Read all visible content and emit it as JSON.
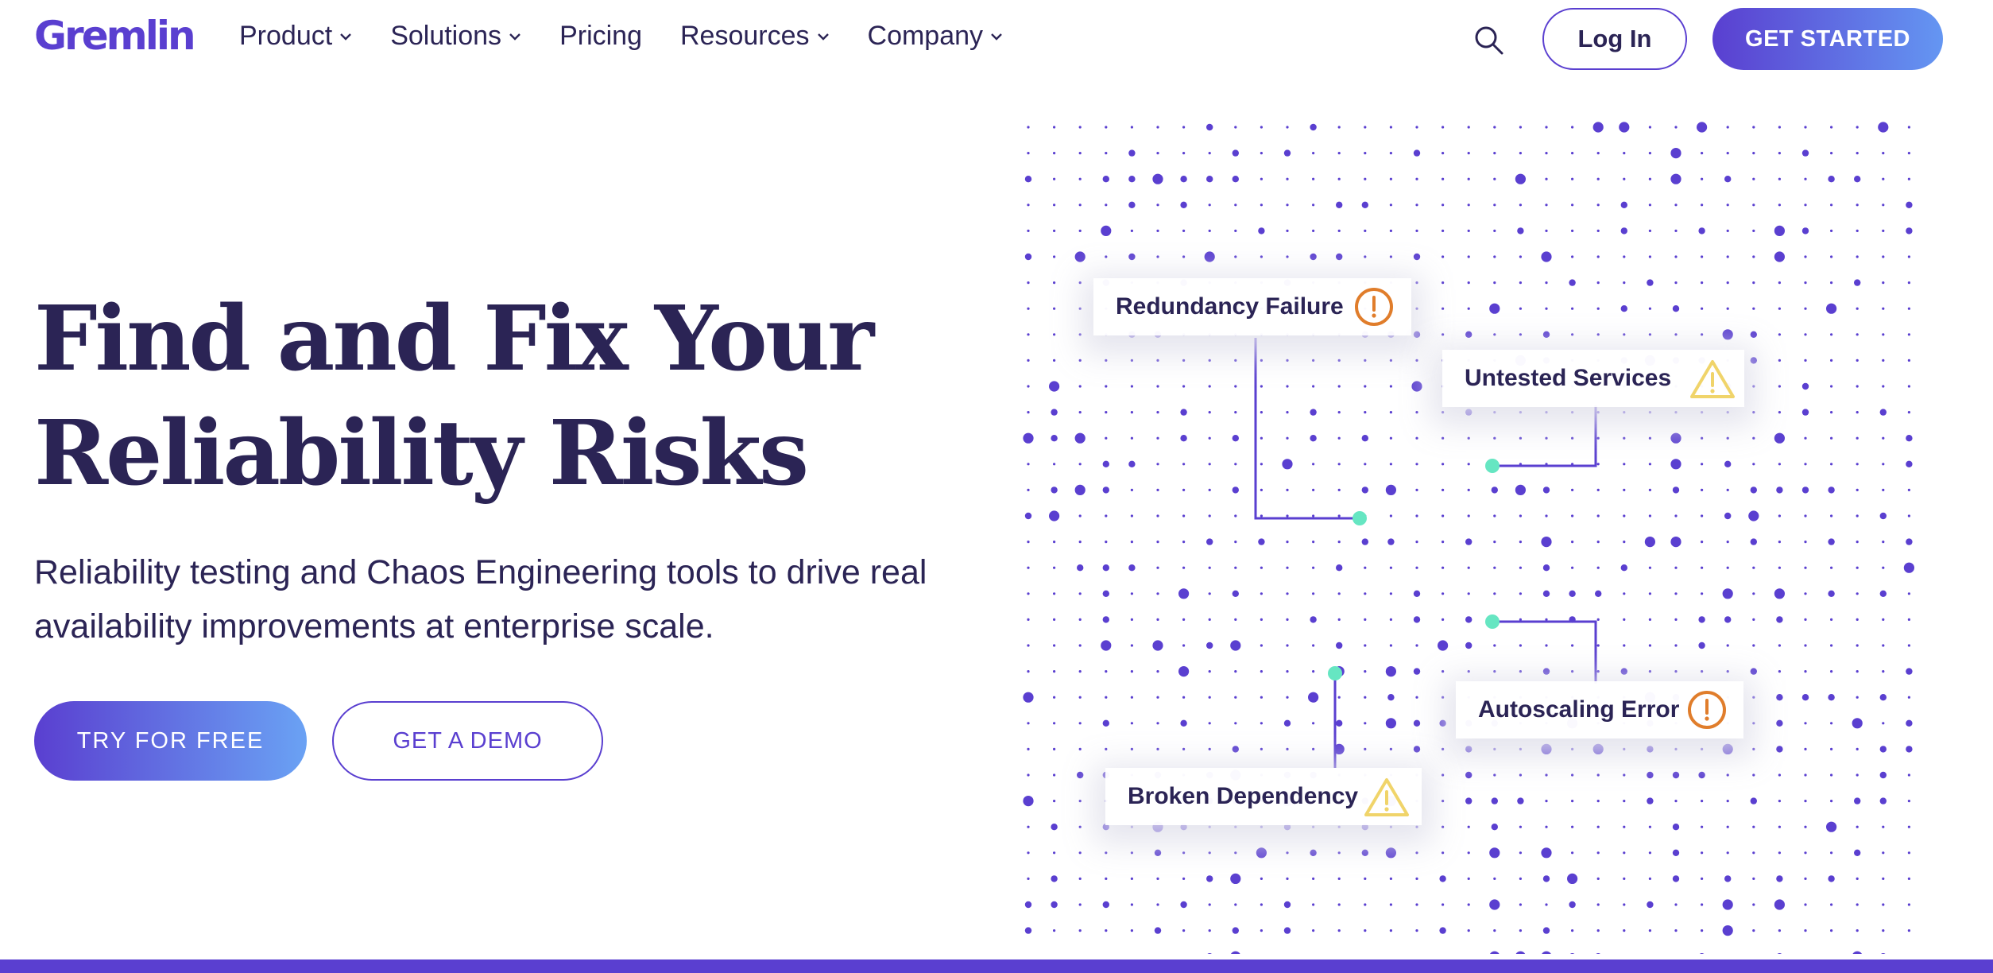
{
  "brand": {
    "logo_text": "Gremlin",
    "primary_color": "#5a3fd0",
    "accent_gradient_end": "#6aa2f4",
    "text_color": "#2b2455"
  },
  "nav": {
    "items": [
      {
        "label": "Product",
        "has_dropdown": true
      },
      {
        "label": "Solutions",
        "has_dropdown": true
      },
      {
        "label": "Pricing",
        "has_dropdown": false
      },
      {
        "label": "Resources",
        "has_dropdown": true
      },
      {
        "label": "Company",
        "has_dropdown": true
      }
    ],
    "search_icon": "search-icon",
    "login_label": "Log In",
    "cta_label": "GET STARTED"
  },
  "hero": {
    "title_line1": "Find and Fix Your",
    "title_line2": "Reliability Risks",
    "subtitle": "Reliability testing and Chaos Engineering tools to drive real availability improvements at enterprise scale.",
    "primary_button": "TRY FOR FREE",
    "secondary_button": "GET A DEMO"
  },
  "illustration": {
    "callouts": [
      {
        "label": "Redundancy Failure",
        "icon": "error-circle-icon",
        "color": "#e07d2b"
      },
      {
        "label": "Untested Services",
        "icon": "warning-triangle-icon",
        "color": "#f0d46a"
      },
      {
        "label": "Autoscaling Error",
        "icon": "error-circle-icon",
        "color": "#e07d2b"
      },
      {
        "label": "Broken Dependency",
        "icon": "warning-triangle-icon",
        "color": "#f0d46a"
      }
    ],
    "dot_color": "#5a3fd0",
    "node_color": "#66e6c2"
  }
}
